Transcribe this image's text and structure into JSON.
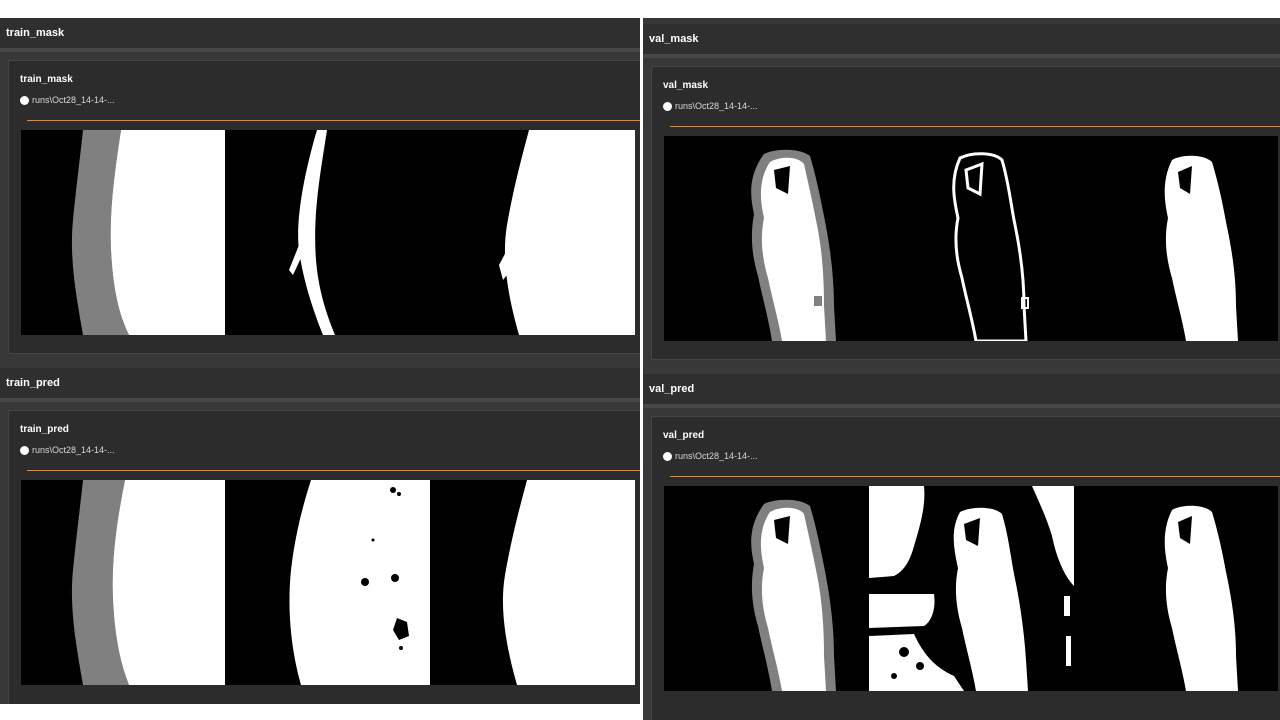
{
  "sections": {
    "train_mask": {
      "header": "train_mask",
      "card_title": "train_mask",
      "run_label": "runs\\Oct28_14-14-..."
    },
    "train_pred": {
      "header": "train_pred",
      "card_title": "train_pred",
      "run_label": "runs\\Oct28_14-14-..."
    },
    "val_mask": {
      "header": "val_mask",
      "card_title": "val_mask",
      "run_label": "runs\\Oct28_14-14-..."
    },
    "val_pred": {
      "header": "val_pred",
      "card_title": "val_pred",
      "run_label": "runs\\Oct28_14-14-..."
    }
  },
  "colors": {
    "run_dot": "#ffffff",
    "accent_line": "#f5870e",
    "panel_bg": "#383838",
    "card_bg": "#2c2c2c",
    "mask_white": "#ffffff",
    "mask_gray": "#808080"
  }
}
